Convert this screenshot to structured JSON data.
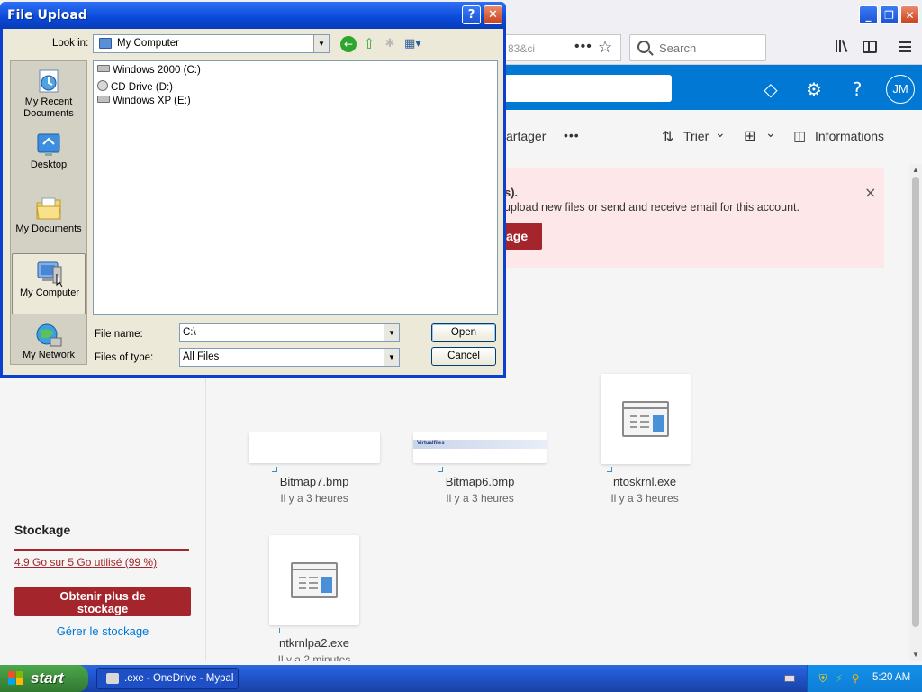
{
  "window": {
    "title": "File Upload"
  },
  "browser": {
    "url_fragment": "83&ci",
    "search_placeholder": "Search",
    "avatar_initials": "JM"
  },
  "onedrive": {
    "command_bar": {
      "share_label": "artager",
      "more_label": "•••",
      "sort_label": "Trier",
      "view_chevron": "⌄",
      "info_label": "Informations"
    },
    "banner": {
      "title_fragment": "s).",
      "message_fragment": "upload new files or send and receive email for this account.",
      "button_fragment": "age",
      "close_glyph": "×"
    },
    "files": [
      {
        "name": "Bitmap7.bmp",
        "date": "Il y a 3 heures"
      },
      {
        "name": "Bitmap6.bmp",
        "date": "Il y a 3 heures",
        "thumb_text": "Virtualfiles"
      },
      {
        "name": "ntoskrnl.exe",
        "date": "Il y a 3 heures"
      },
      {
        "name": "ntkrnlpa2.exe",
        "date": "Il y a 2 minutes"
      }
    ],
    "storage": {
      "title": "Stockage",
      "used": "4.9 Go sur 5 Go utilisé (99 %)",
      "get_more_line1": "Obtenir plus de",
      "get_more_line2": "stockage",
      "manage": "Gérer le stockage"
    }
  },
  "dialog": {
    "look_in_label": "Look in:",
    "look_in_value": "My Computer",
    "places": [
      {
        "label1": "My Recent",
        "label2": "Documents"
      },
      {
        "label1": "Desktop",
        "label2": ""
      },
      {
        "label1": "My Documents",
        "label2": ""
      },
      {
        "label1": "My Computer",
        "label2": ""
      },
      {
        "label1": "My Network",
        "label2": ""
      }
    ],
    "drives": [
      "Windows 2000 (C:)",
      "CD Drive (D:)",
      "Windows XP (E:)"
    ],
    "file_name_label": "File name:",
    "file_name_value": "C:\\",
    "files_of_type_label": "Files of type:",
    "files_of_type_value": "All Files",
    "open_button": "Open",
    "cancel_button": "Cancel"
  },
  "taskbar": {
    "start_label": "start",
    "task_item": ".exe - OneDrive - Mypal",
    "clock": "5:20 AM"
  },
  "colors": {
    "onedrive_blue": "#0078d4",
    "storage_red": "#a4262c",
    "banner_bg": "#fde7e9",
    "xp_title_blue": "#0a49d8",
    "xp_face": "#ece9d8"
  }
}
